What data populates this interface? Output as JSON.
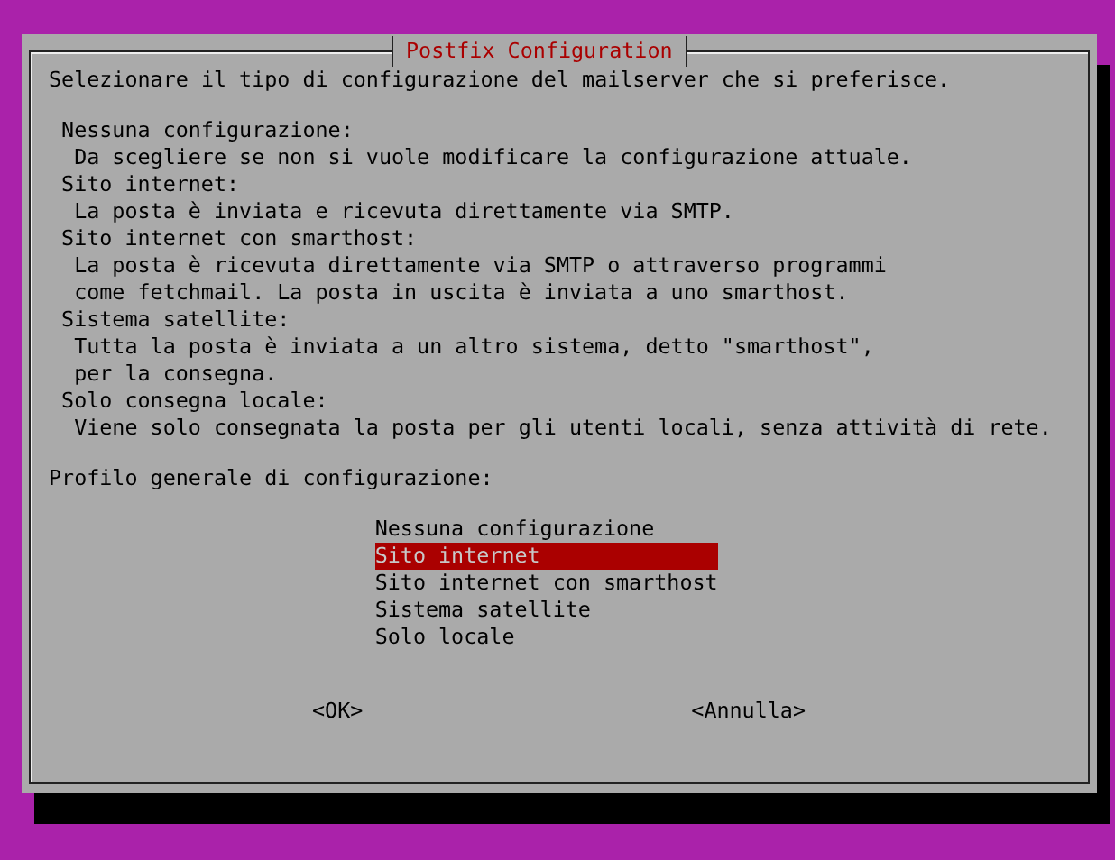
{
  "dialog": {
    "title": "Postfix Configuration",
    "prompt": "Selezionare il tipo di configurazione del mailserver che si preferisce.",
    "help": [
      {
        "name": "Nessuna configurazione:",
        "description": "Da scegliere se non si vuole modificare la configurazione attuale."
      },
      {
        "name": "Sito internet:",
        "description": "La posta è inviata e ricevuta direttamente via SMTP."
      },
      {
        "name": "Sito internet con smarthost:",
        "description": "La posta è ricevuta direttamente via SMTP o attraverso programmi\ncome fetchmail. La posta in uscita è inviata a uno smarthost."
      },
      {
        "name": "Sistema satellite:",
        "description": "Tutta la posta è inviata a un altro sistema, detto \"smarthost\",\nper la consegna."
      },
      {
        "name": "Solo consegna locale:",
        "description": "Viene solo consegnata la posta per gli utenti locali, senza attività di rete."
      }
    ],
    "list_label": "Profilo generale di configurazione:",
    "choices": [
      {
        "label": "Nessuna configurazione",
        "selected": false
      },
      {
        "label": "Sito internet",
        "selected": true
      },
      {
        "label": "Sito internet con smarthost",
        "selected": false
      },
      {
        "label": "Sistema satellite",
        "selected": false
      },
      {
        "label": "Solo locale",
        "selected": false
      }
    ],
    "buttons": [
      "<OK>",
      "<Annulla>"
    ]
  }
}
